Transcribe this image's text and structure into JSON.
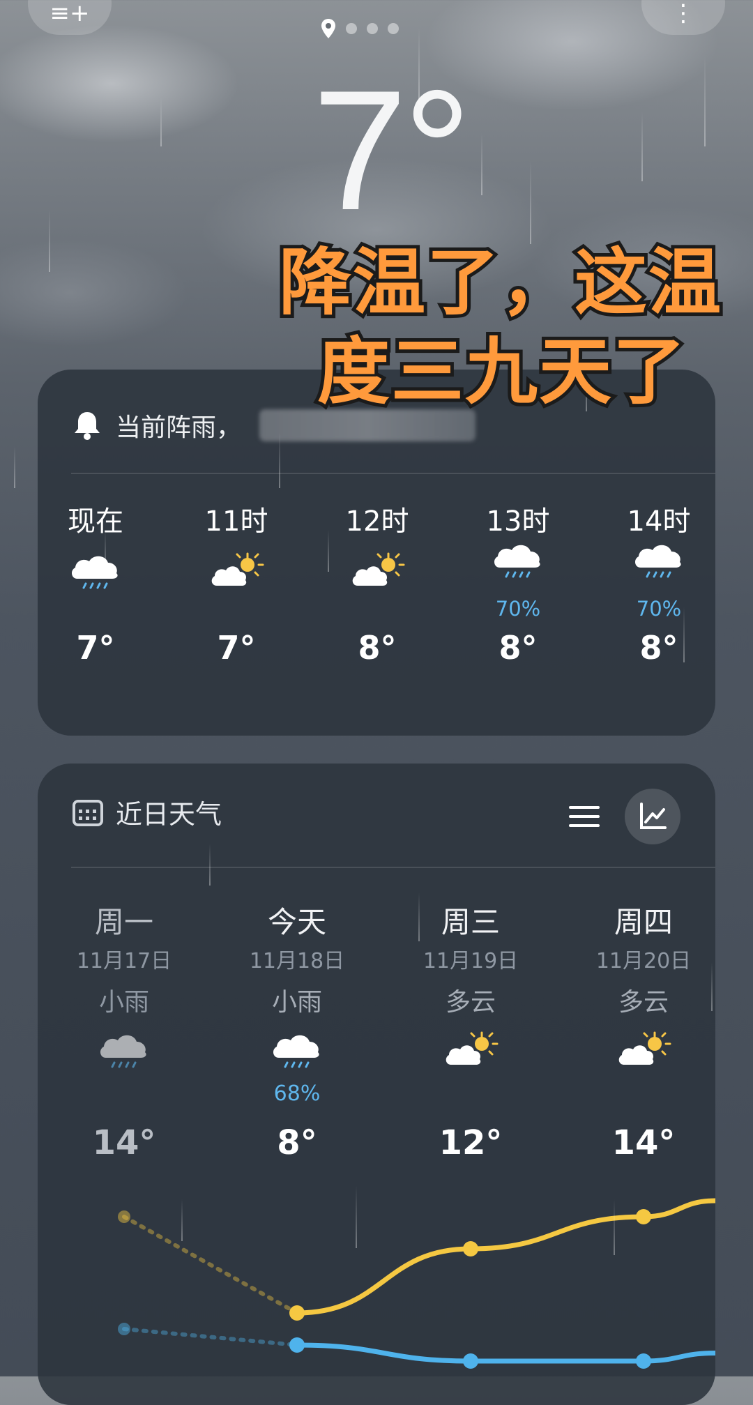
{
  "header": {
    "temperature": "7°",
    "menu_glyph": "≡+",
    "more_glyph": "⋮"
  },
  "overlay": {
    "line1": "降温了，这温",
    "line2": "度三九天了"
  },
  "alert": {
    "text": "当前阵雨，"
  },
  "hourly": [
    {
      "label": "现在",
      "icon": "rain-cloud-icon",
      "temp": "7°",
      "precip": ""
    },
    {
      "label": "11时",
      "icon": "partly-cloudy-icon",
      "temp": "7°",
      "precip": ""
    },
    {
      "label": "12时",
      "icon": "partly-cloudy-icon",
      "temp": "8°",
      "precip": ""
    },
    {
      "label": "13时",
      "icon": "rain-cloud-icon",
      "temp": "8°",
      "precip": "70%"
    },
    {
      "label": "14时",
      "icon": "rain-cloud-icon",
      "temp": "8°",
      "precip": "70%"
    }
  ],
  "daily": {
    "title": "近日天气",
    "days": [
      {
        "name": "周一",
        "date": "11月17日",
        "cond": "小雨",
        "icon": "rain-cloud-icon",
        "precip": "",
        "high": "14°",
        "past": true
      },
      {
        "name": "今天",
        "date": "11月18日",
        "cond": "小雨",
        "icon": "rain-cloud-icon",
        "precip": "68%",
        "high": "8°",
        "past": false
      },
      {
        "name": "周三",
        "date": "11月19日",
        "cond": "多云",
        "icon": "partly-cloudy-icon",
        "precip": "",
        "high": "12°",
        "past": false
      },
      {
        "name": "周四",
        "date": "11月20日",
        "cond": "多云",
        "icon": "partly-cloudy-icon",
        "precip": "",
        "high": "14°",
        "past": false
      }
    ]
  },
  "colors": {
    "high_line": "#f5c842",
    "low_line": "#4fb3ec",
    "precip": "#5fb7ee"
  },
  "trend": {
    "high": [
      14,
      8,
      12,
      14
    ],
    "low": [
      7,
      6,
      5,
      5
    ],
    "past_count": 1
  }
}
